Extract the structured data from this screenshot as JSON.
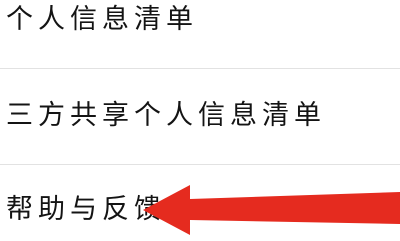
{
  "settings_list": {
    "items": [
      {
        "label": "个人信息清单"
      },
      {
        "label": "三方共享个人信息清单"
      },
      {
        "label": "帮助与反馈"
      }
    ]
  },
  "colors": {
    "annotation_arrow": "#e52b1f",
    "divider": "#e2e2e2",
    "text": "#141414"
  },
  "icons": {
    "annotation": "arrow-left-icon"
  }
}
